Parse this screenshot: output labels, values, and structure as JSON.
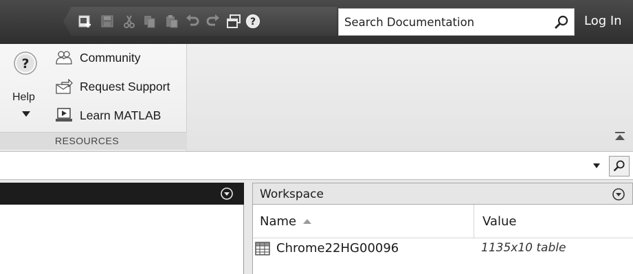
{
  "toolbar": {
    "icons": [
      "new-script-icon",
      "save-icon",
      "cut-icon",
      "copy-icon",
      "paste-icon",
      "undo-icon",
      "redo-icon",
      "switch-windows-icon",
      "help-icon"
    ],
    "search_placeholder": "Search Documentation",
    "login_label": "Log In"
  },
  "ribbon": {
    "help_label": "Help",
    "resources": {
      "items": [
        {
          "label": "Community",
          "icon": "community-icon"
        },
        {
          "label": "Request Support",
          "icon": "request-support-icon"
        },
        {
          "label": "Learn MATLAB",
          "icon": "learn-matlab-icon"
        }
      ],
      "section_title": "RESOURCES"
    }
  },
  "workspace": {
    "title": "Workspace",
    "columns": [
      "Name",
      "Value"
    ],
    "rows": [
      {
        "name": "Chrome22HG00096",
        "value": "1135x10 table",
        "icon": "table-icon"
      }
    ]
  }
}
